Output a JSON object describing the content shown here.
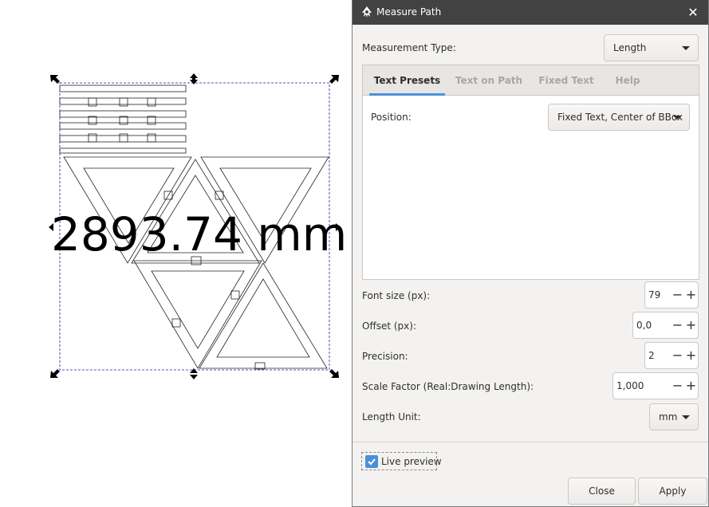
{
  "canvas": {
    "measurement_text": "2893.74 mm"
  },
  "dialog": {
    "title": "Measure Path",
    "close_glyph": "✕",
    "measurement_type": {
      "label": "Measurement Type:",
      "value": "Length"
    },
    "tabs": [
      {
        "label": "Text Presets",
        "active": true
      },
      {
        "label": "Text on Path",
        "active": false
      },
      {
        "label": "Fixed Text",
        "active": false
      },
      {
        "label": "Help",
        "active": false
      }
    ],
    "position": {
      "label": "Position:",
      "value": "Fixed Text, Center of BBox"
    },
    "font_size": {
      "label": "Font size (px):",
      "value": "79"
    },
    "offset": {
      "label": "Offset (px):",
      "value": "0,0"
    },
    "precision": {
      "label": "Precision:",
      "value": "2"
    },
    "scale_factor": {
      "label": "Scale Factor (Real:Drawing Length):",
      "value": "1,000"
    },
    "length_unit": {
      "label": "Length Unit:",
      "value": "mm"
    },
    "live_preview": {
      "label": "Live preview",
      "checked": true
    },
    "buttons": {
      "close": "Close",
      "apply": "Apply"
    },
    "spin_minus": "−",
    "spin_plus": "+"
  },
  "colors": {
    "accent": "#4a90d9",
    "titlebar": "#424242",
    "dialog_bg": "#f3f2f1",
    "selection": "#1a1ab0"
  },
  "icons": [
    "inkscape-app-icon",
    "close-icon",
    "dropdown-arrow-icon",
    "checkmark-icon",
    "transform-arrow-icon"
  ]
}
